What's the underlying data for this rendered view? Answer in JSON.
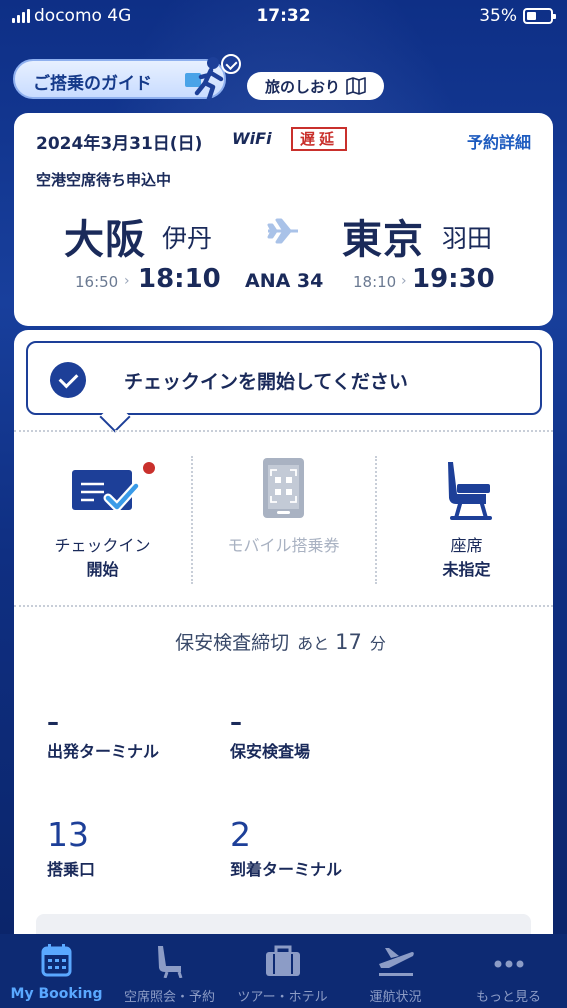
{
  "status_bar": {
    "carrier": "docomo  4G",
    "time": "17:32",
    "battery": "35%"
  },
  "header": {
    "guide_label": "ご搭乗のガイド",
    "bookmark_label": "旅のしおり"
  },
  "flight": {
    "date": "2024年3月31日(日)",
    "wifi_label": "WiFi",
    "status_badge": "遅延",
    "details_link": "予約詳細",
    "standby_status": "空港空席待ち申込中",
    "origin_city": "大阪",
    "origin_airport": "伊丹",
    "destination_city": "東京",
    "destination_airport": "羽田",
    "departure_scheduled": "16:50",
    "departure_actual": "18:10",
    "flight_number": "ANA 34",
    "arrival_scheduled": "18:10",
    "arrival_actual": "19:30"
  },
  "checkin_banner": {
    "text": "チェックインを開始してください"
  },
  "actions": [
    {
      "label": "チェックイン",
      "sub": "開始",
      "icon": "checkin-card-icon"
    },
    {
      "label": "モバイル搭乗券",
      "sub": "",
      "icon": "mobile-qr-icon"
    },
    {
      "label": "座席",
      "sub": "未指定",
      "icon": "seat-icon"
    }
  ],
  "security_deadline": {
    "label": "保安検査締切",
    "prefix": "あと",
    "minutes": "17",
    "unit": "分"
  },
  "info": {
    "departure_terminal": {
      "value": "–",
      "caption": "出発ターミナル"
    },
    "security_checkpoint": {
      "value": "–",
      "caption": "保安検査場"
    },
    "boarding_gate": {
      "value": "13",
      "caption": "搭乗口"
    },
    "arrival_terminal": {
      "value": "2",
      "caption": "到着ターミナル"
    }
  },
  "tabs": [
    {
      "label": "My Booking",
      "icon": "calendar-icon",
      "active": true
    },
    {
      "label": "空席照会・予約",
      "icon": "seat-icon",
      "active": false
    },
    {
      "label": "ツアー・ホテル",
      "icon": "suitcase-icon",
      "active": false
    },
    {
      "label": "運航状況",
      "icon": "plane-departure-icon",
      "active": false
    },
    {
      "label": "もっと見る",
      "icon": "more-icon",
      "active": false
    }
  ],
  "colors": {
    "brand_navy": "#1d3f98",
    "delay_red": "#c9302c",
    "link_blue": "#1d5bbf",
    "tab_active": "#5aa8ff",
    "tab_bar": "#0d2a73"
  }
}
